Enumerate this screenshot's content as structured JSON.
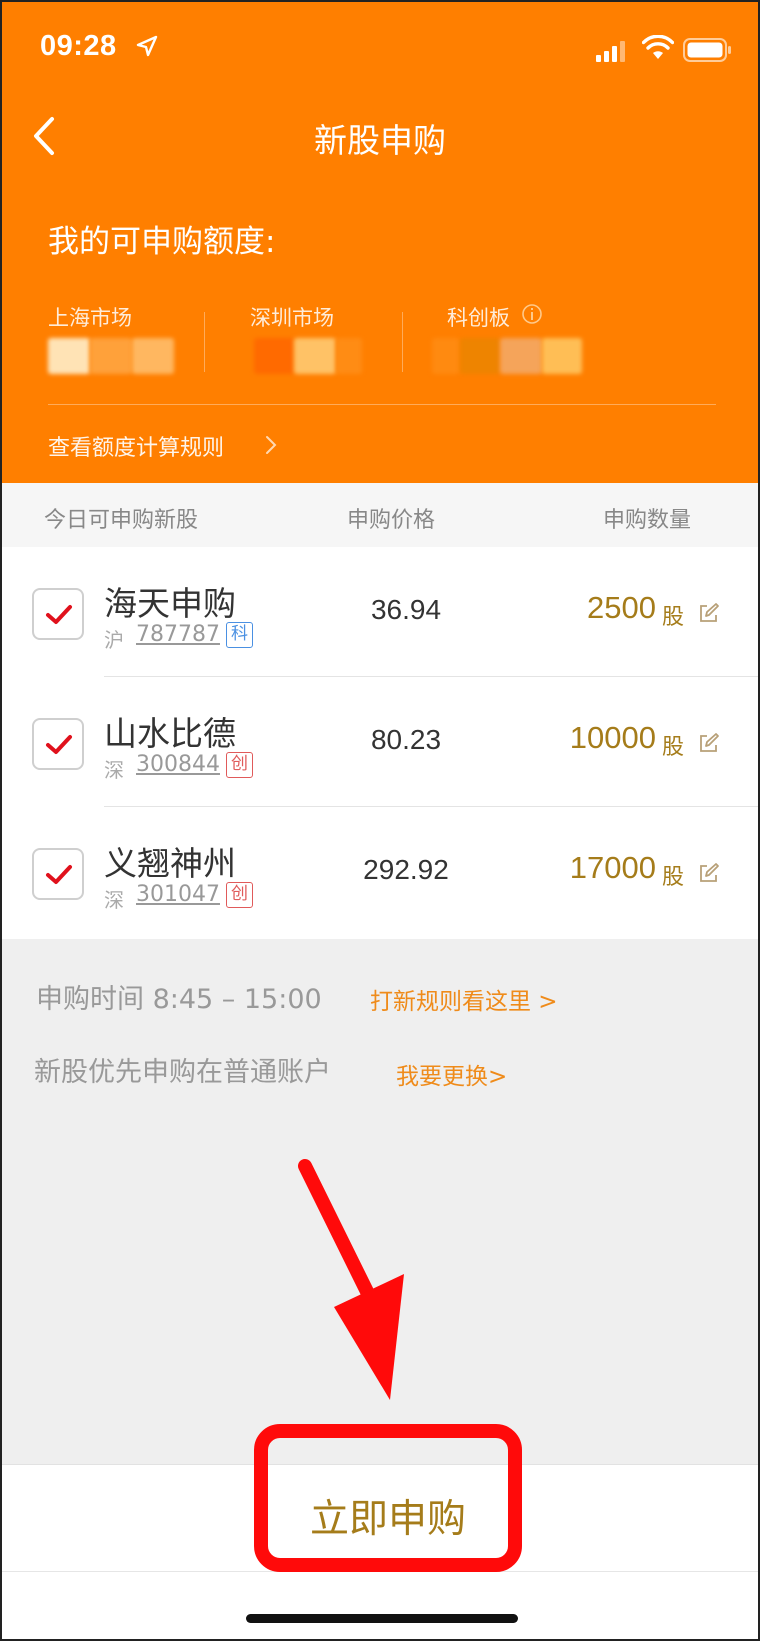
{
  "status_bar": {
    "time": "09:28"
  },
  "header": {
    "title": "新股申购"
  },
  "quota": {
    "label": "我的可申购额度:",
    "markets": [
      "上海市场",
      "深圳市场",
      "科创板"
    ],
    "rules_link": "查看额度计算规则"
  },
  "table": {
    "headers": [
      "今日可申购新股",
      "申购价格",
      "申购数量"
    ],
    "rows": [
      {
        "name": "海天申购",
        "exchange": "沪",
        "code": "787787",
        "tag": "科",
        "price": "36.94",
        "quantity": "2500",
        "unit": "股",
        "checked": true
      },
      {
        "name": "山水比德",
        "exchange": "深",
        "code": "300844",
        "tag": "创",
        "price": "80.23",
        "quantity": "10000",
        "unit": "股",
        "checked": true
      },
      {
        "name": "义翘神州",
        "exchange": "深",
        "code": "301047",
        "tag": "创",
        "price": "292.92",
        "quantity": "17000",
        "unit": "股",
        "checked": true
      }
    ]
  },
  "info": {
    "time_text": "申购时间 8:45 – 15:00",
    "time_link": "打新规则看这里 >",
    "account_text": "新股优先申购在普通账户",
    "account_link": "我要更换>"
  },
  "footer": {
    "submit_label": "立即申购"
  },
  "colors": {
    "header_bg": "#ff7f00",
    "accent_gold": "#a57c1a",
    "link_orange": "#ef8b1a",
    "annotation_red": "#ff0a0a"
  }
}
